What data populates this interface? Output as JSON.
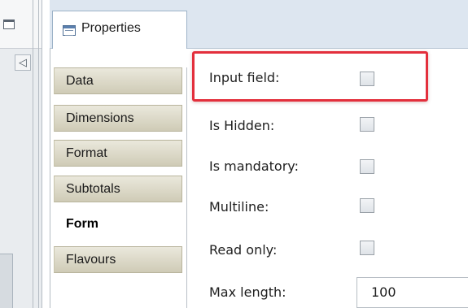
{
  "panel": {
    "title": "Properties",
    "collapse_glyph": "◁"
  },
  "tabs": [
    {
      "label": "Data",
      "active": false
    },
    {
      "label": "Dimensions",
      "active": false
    },
    {
      "label": "Format",
      "active": false
    },
    {
      "label": "Subtotals",
      "active": false
    },
    {
      "label": "Form",
      "active": true
    },
    {
      "label": "Flavours",
      "active": false
    }
  ],
  "form": {
    "input_field": {
      "label": "Input field:",
      "checked": false
    },
    "is_hidden": {
      "label": "Is Hidden:",
      "checked": false
    },
    "is_mandatory": {
      "label": "Is mandatory:",
      "checked": false
    },
    "multiline": {
      "label": "Multiline:",
      "checked": false
    },
    "read_only": {
      "label": "Read only:",
      "checked": false
    },
    "max_length": {
      "label": "Max length:",
      "value": "100"
    }
  },
  "colors": {
    "highlight": "#e32f3c",
    "title_bar": "#dde6f0",
    "tab_gradient_top": "#eae8dc",
    "tab_gradient_bottom": "#cfcbb6"
  }
}
